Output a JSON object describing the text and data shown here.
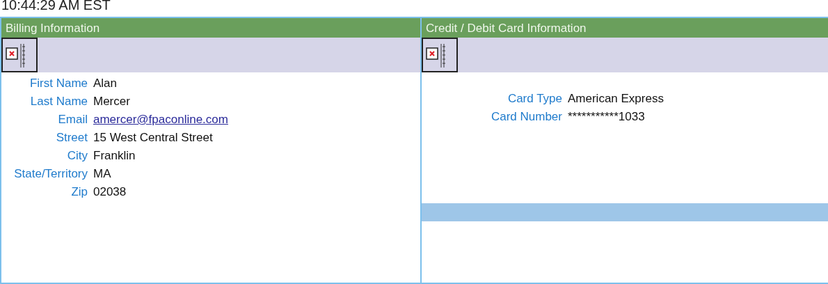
{
  "timestamp": "10:44:29 AM EST",
  "panels": [
    {
      "title": "Billing Information",
      "fields": [
        {
          "label": "First Name",
          "value": "Alan",
          "kind": "text"
        },
        {
          "label": "Last Name",
          "value": "Mercer",
          "kind": "text"
        },
        {
          "label": "Email",
          "value": "amercer@fpaconline.com",
          "kind": "link"
        },
        {
          "label": "Street",
          "value": "15 West Central Street",
          "kind": "text"
        },
        {
          "label": "City",
          "value": "Franklin",
          "kind": "text"
        },
        {
          "label": "State/Territory",
          "value": "MA",
          "kind": "text"
        },
        {
          "label": "Zip",
          "value": "02038",
          "kind": "text"
        }
      ],
      "footer_band": false
    },
    {
      "title": "Credit / Debit Card Information",
      "fields": [
        {
          "label": "Card Type",
          "value": "American Express",
          "kind": "text"
        },
        {
          "label": "Card Number",
          "value": "***********1033",
          "kind": "text"
        }
      ],
      "footer_band": true
    }
  ]
}
